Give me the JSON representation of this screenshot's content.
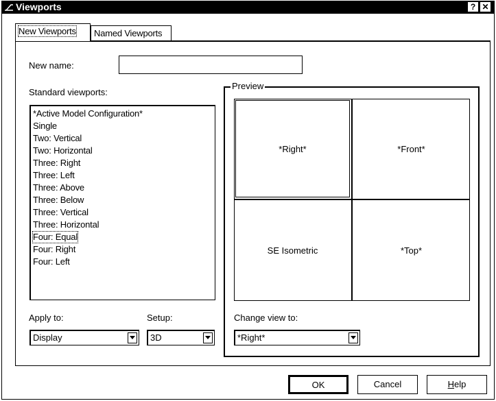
{
  "window": {
    "title": "Viewports",
    "help_label": "?",
    "close_label": "✕"
  },
  "tabs": [
    {
      "label": "New Viewports",
      "active": true
    },
    {
      "label": "Named Viewports",
      "active": false
    }
  ],
  "new_name": {
    "label": "New name:",
    "value": ""
  },
  "standard_viewports": {
    "label": "Standard viewports:",
    "items": [
      "*Active Model Configuration*",
      "Single",
      "Two:  Vertical",
      "Two:  Horizontal",
      "Three: Right",
      "Three: Left",
      "Three: Above",
      "Three: Below",
      "Three: Vertical",
      "Three: Horizontal",
      "Four:  Equal",
      "Four:  Right",
      "Four:  Left"
    ],
    "selected": "Four:  Equal"
  },
  "preview": {
    "label": "Preview",
    "viewports": {
      "top_left": "*Right*",
      "top_right": "*Front*",
      "bottom_left": "SE Isometric",
      "bottom_right": "*Top*"
    }
  },
  "apply_to": {
    "label": "Apply to:",
    "value": "Display"
  },
  "setup": {
    "label": "Setup:",
    "value": "3D"
  },
  "change_view": {
    "label": "Change view to:",
    "value": "*Right*"
  },
  "buttons": {
    "ok": "OK",
    "cancel": "Cancel",
    "help_first": "H",
    "help_rest": "elp"
  }
}
